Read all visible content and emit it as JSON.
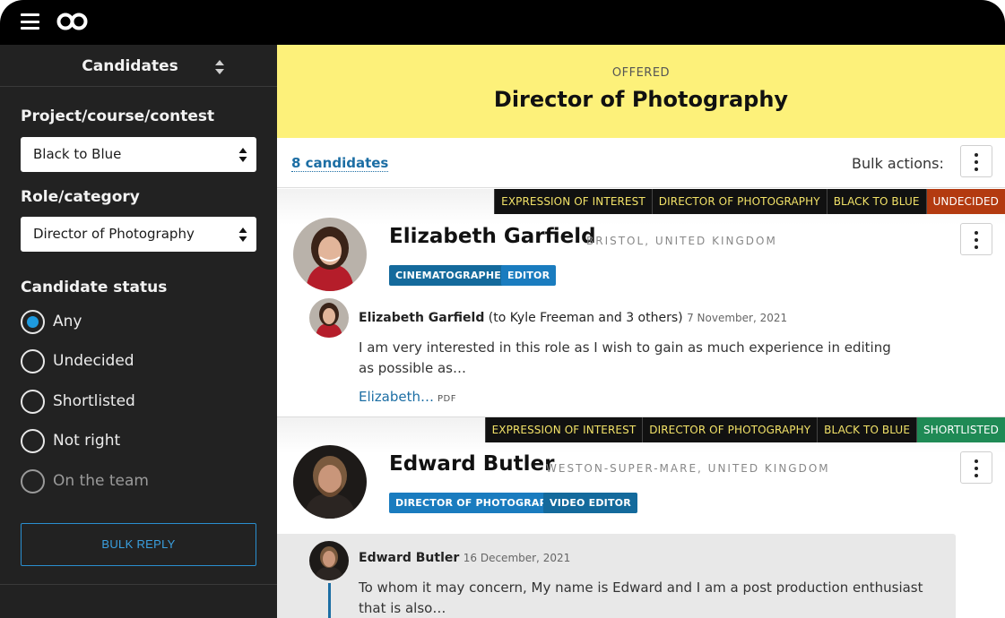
{
  "sidebar": {
    "title": "Candidates",
    "project_label": "Project/course/contest",
    "project_value": "Black to Blue",
    "role_label": "Role/category",
    "role_value": "Director of Photography",
    "status_label": "Candidate status",
    "status_options": [
      {
        "label": "Any",
        "checked": true
      },
      {
        "label": "Undecided",
        "checked": false
      },
      {
        "label": "Shortlisted",
        "checked": false
      },
      {
        "label": "Not right",
        "checked": false
      },
      {
        "label": "On the team",
        "checked": false,
        "disabled": true
      }
    ],
    "bulk_reply": "BULK REPLY"
  },
  "banner": {
    "status": "OFFERED",
    "title": "Director of Photography"
  },
  "toolbar": {
    "count": "8 candidates",
    "bulk_actions": "Bulk actions:"
  },
  "candidates": [
    {
      "tags": [
        "EXPRESSION OF INTEREST",
        "DIRECTOR OF PHOTOGRAPHY",
        "BLACK TO BLUE"
      ],
      "status": "UNDECIDED",
      "name": "Elizabeth Garfield",
      "location": "BRISTOL, UNITED KINGDOM",
      "skills": [
        "CINEMATOGRAPHER",
        "EDITOR"
      ],
      "message": {
        "author": "Elizabeth Garfield",
        "recipients": "(to Kyle Freeman and 3 others)",
        "date": "7 November, 2021",
        "body": "I am very interested in this role as I wish to gain as much experience in editing as possible as…",
        "attachment": "Elizabeth…",
        "attachment_type": "PDF"
      }
    },
    {
      "tags": [
        "EXPRESSION OF INTEREST",
        "DIRECTOR OF PHOTOGRAPHY",
        "BLACK TO BLUE"
      ],
      "status": "SHORTLISTED",
      "name": "Edward Butler",
      "location": "WESTON-SUPER-MARE, UNITED KINGDOM",
      "skills": [
        "DIRECTOR OF PHOTOGRAPHY",
        "VIDEO EDITOR"
      ],
      "message": {
        "author": "Edward Butler",
        "date": "16 December, 2021",
        "body": "To whom it may concern, My name is Edward and I am a post production enthusiast that is also…"
      }
    }
  ],
  "colors": {
    "banner": "#fdf17a",
    "sidebar": "#222222",
    "link": "#1c6ea4",
    "radio_checked": "#1e9be0",
    "undecided": "#b33a10",
    "shortlisted": "#1f8a55",
    "tag_text": "#f2e268"
  }
}
